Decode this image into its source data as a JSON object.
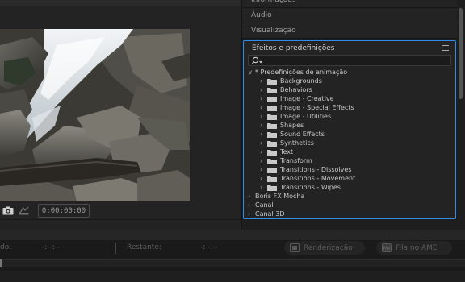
{
  "monitor": {
    "timecode": "0:00:00:00"
  },
  "panels": {
    "informacoes": "Informações",
    "audio": "Áudio",
    "visualizacao": "Visualização"
  },
  "effects": {
    "title": "Efeitos e predefinições",
    "search_value": "",
    "tree": [
      {
        "label": "* Predefinições de animação",
        "level": 0,
        "expanded": true,
        "folder": false
      },
      {
        "label": "Backgrounds",
        "level": 1,
        "expanded": false,
        "folder": true
      },
      {
        "label": "Behaviors",
        "level": 1,
        "expanded": false,
        "folder": true
      },
      {
        "label": "Image - Creative",
        "level": 1,
        "expanded": false,
        "folder": true
      },
      {
        "label": "Image - Special Effects",
        "level": 1,
        "expanded": false,
        "folder": true
      },
      {
        "label": "Image - Utilities",
        "level": 1,
        "expanded": false,
        "folder": true
      },
      {
        "label": "Shapes",
        "level": 1,
        "expanded": false,
        "folder": true
      },
      {
        "label": "Sound Effects",
        "level": 1,
        "expanded": false,
        "folder": true
      },
      {
        "label": "Synthetics",
        "level": 1,
        "expanded": false,
        "folder": true
      },
      {
        "label": "Text",
        "level": 1,
        "expanded": false,
        "folder": true
      },
      {
        "label": "Transform",
        "level": 1,
        "expanded": false,
        "folder": true
      },
      {
        "label": "Transitions - Dissolves",
        "level": 1,
        "expanded": false,
        "folder": true
      },
      {
        "label": "Transitions - Movement",
        "level": 1,
        "expanded": false,
        "folder": true
      },
      {
        "label": "Transitions - Wipes",
        "level": 1,
        "expanded": false,
        "folder": true
      },
      {
        "label": "Boris FX Mocha",
        "level": 0,
        "expanded": false,
        "folder": false
      },
      {
        "label": "Canal",
        "level": 0,
        "expanded": false,
        "folder": false
      },
      {
        "label": "Canal 3D",
        "level": 0,
        "expanded": false,
        "folder": false
      }
    ]
  },
  "render_bar": {
    "elapsed_label": "do:",
    "elapsed_value": "-:--:--",
    "remaining_label": "Restante:",
    "remaining_value": "-:--:--",
    "render_button": "Renderização",
    "ame_button": "Fila no AME",
    "progress": 0
  },
  "colors": {
    "accent": "#2d8ceb",
    "panel_bg": "#232323",
    "app_bg": "#1d1d1d"
  }
}
